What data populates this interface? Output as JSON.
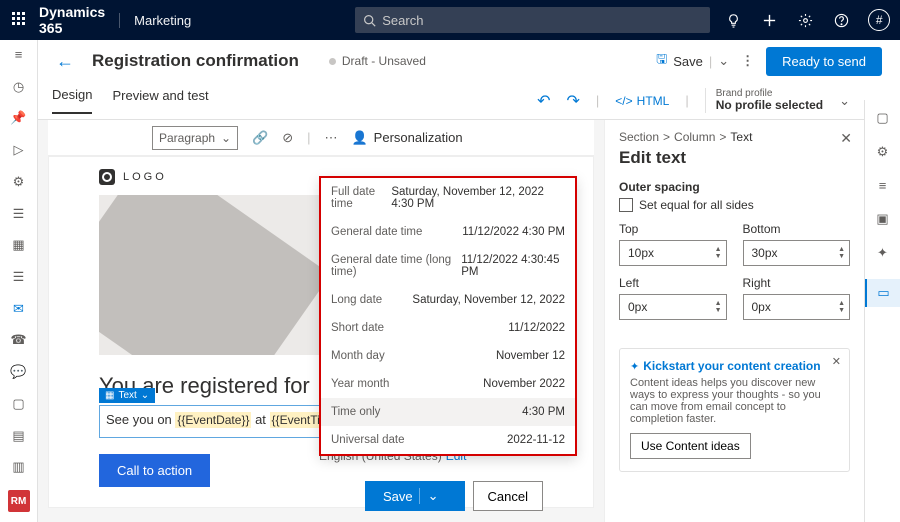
{
  "brand": "Dynamics 365",
  "module": "Marketing",
  "search_placeholder": "Search",
  "avatar_initial": "#",
  "page_title": "Registration confirmation",
  "status": "Draft - Unsaved",
  "save_label": "Save",
  "ready_label": "Ready to send",
  "tabs": {
    "design": "Design",
    "preview": "Preview and test"
  },
  "html_label": "HTML",
  "brand_profile": {
    "label": "Brand profile",
    "value": "No profile selected"
  },
  "toolbar": {
    "paragraph": "Paragraph",
    "personalization": "Personalization"
  },
  "canvas": {
    "logo_text": "LOGO",
    "headline": "You are registered for",
    "text_tag": "Text",
    "body_prefix": "See you on ",
    "token1": "{{EventDate}}",
    "body_mid": " at ",
    "token2": "{{EventTime}}",
    "body_suffix": ".",
    "cta": "Call to action"
  },
  "side": {
    "crumb1": "Section",
    "crumb2": "Column",
    "crumb3": "Text",
    "title": "Edit text",
    "outer": "Outer spacing",
    "equal": "Set equal for all sides",
    "top": "Top",
    "bottom": "Bottom",
    "left": "Left",
    "right": "Right",
    "vtop": "10px",
    "vbottom": "30px",
    "vleft": "0px",
    "vright": "0px",
    "tip_title": "Kickstart your content creation",
    "tip_body": "Content ideas helps you discover new ways to express your thoughts - so you can move from email concept to completion faster.",
    "tip_btn": "Use Content ideas"
  },
  "popup": {
    "rows": [
      {
        "l": "Full date time",
        "v": "Saturday, November 12, 2022 4:30 PM"
      },
      {
        "l": "General date time",
        "v": "11/12/2022 4:30 PM"
      },
      {
        "l": "General date time (long time)",
        "v": "11/12/2022 4:30:45 PM"
      },
      {
        "l": "Long date",
        "v": "Saturday, November 12, 2022"
      },
      {
        "l": "Short date",
        "v": "11/12/2022"
      },
      {
        "l": "Month day",
        "v": "November 12"
      },
      {
        "l": "Year month",
        "v": "November 2022"
      },
      {
        "l": "Time only",
        "v": "4:30 PM"
      },
      {
        "l": "Universal date",
        "v": "2022-11-12"
      }
    ],
    "selected": "4:30 PM",
    "locale": "English (United States)",
    "edit": "Edit",
    "save": "Save",
    "cancel": "Cancel"
  },
  "rm": "RM"
}
